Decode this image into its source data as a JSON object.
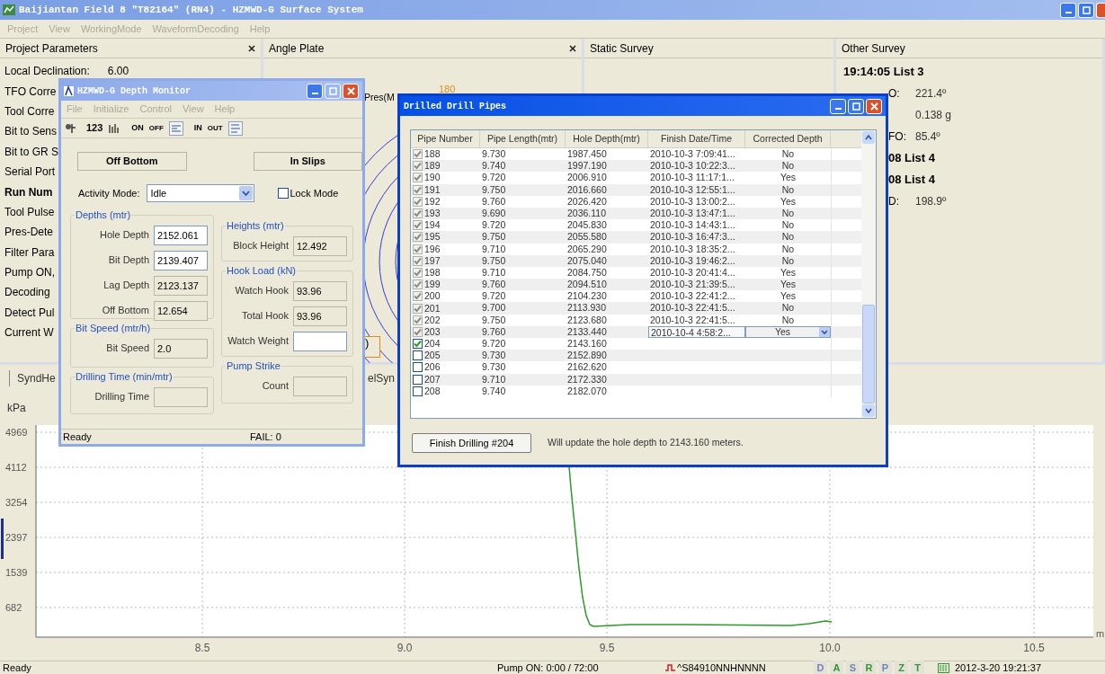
{
  "window": {
    "title": "Baijiantan Field 8 \"T82164\" (RN4) - HZMWD-G Surface System"
  },
  "menu": [
    {
      "label": "Project",
      "disabled": true
    },
    {
      "label": "View",
      "disabled": true
    },
    {
      "label": "WorkingMode",
      "disabled": true
    },
    {
      "label": "WaveformDecoding",
      "disabled": true
    },
    {
      "label": "Help",
      "disabled": true
    }
  ],
  "panels": [
    {
      "title": "Project Parameters",
      "closable": true
    },
    {
      "title": "Angle Plate",
      "closable": true
    },
    {
      "title": "Static Survey",
      "closable": false
    },
    {
      "title": "Other Survey",
      "closable": false
    }
  ],
  "project_parameters": [
    {
      "label": "Local Declination:",
      "value": "6.00",
      "bold": false
    },
    {
      "label": "TFO Corre",
      "bold": false
    },
    {
      "label": "Tool Corre",
      "bold": false
    },
    {
      "label": "Bit to Sens",
      "bold": false
    },
    {
      "label": "Bit to GR S",
      "bold": false
    },
    {
      "label": "Serial Port",
      "bold": false
    },
    {
      "label": "Run Num",
      "bold": true
    },
    {
      "label": "Tool Pulse",
      "bold": false
    },
    {
      "label": "Pres-Dete",
      "bold": false
    },
    {
      "label": "Filter Para",
      "bold": false
    },
    {
      "label": "Pump ON,",
      "bold": false
    },
    {
      "label": "Decoding",
      "bold": false
    },
    {
      "label": "Detect Pul",
      "bold": false
    },
    {
      "label": "Current W",
      "bold": false
    }
  ],
  "angle_plate": {
    "pressure_label": "Pres(M",
    "angle_label": "180",
    "box_label": ")"
  },
  "other_survey": [
    {
      "label": "19:14:05 List 3",
      "bold": true
    },
    {
      "label": "O:",
      "value": "221.4º",
      "bold": false
    },
    {
      "value": "0.138 g"
    },
    {
      "label": "FO:",
      "value": "85.4º",
      "bold": false
    },
    {
      "label": "08 List 4",
      "bold": true
    },
    {
      "label": "08 List 4",
      "bold": true
    },
    {
      "label": "D:",
      "value": "198.9º",
      "bold": false
    }
  ],
  "trend": {
    "tabs": [
      "SyndHe",
      "elSyn"
    ],
    "unit": "kPa",
    "x_unit": "m",
    "y_labels": [
      "4969",
      "4112",
      "3254",
      "2397",
      "1539",
      "682"
    ],
    "x_labels": [
      "8.5",
      "9.0",
      "9.5",
      "10.0",
      "10.5"
    ]
  },
  "status_bar": {
    "text": "Ready",
    "pump": "Pump ON: 0:00 / 72:00",
    "code": "^S84910NNHNNNN",
    "flags": [
      {
        "label": "D",
        "color": "#6f86b8"
      },
      {
        "label": "A",
        "color": "#2f9a2f"
      },
      {
        "label": "S",
        "color": "#6f86b8"
      },
      {
        "label": "R",
        "color": "#2f9a2f"
      },
      {
        "label": "P",
        "color": "#6f86b8"
      },
      {
        "label": "Z",
        "color": "#2f9a2f"
      },
      {
        "label": "T",
        "color": "#2f9a2f"
      }
    ],
    "datetime": "2012-3-20 19:21:37"
  },
  "depth_monitor": {
    "title": "HZMWD-G Depth Monitor",
    "menu": [
      {
        "label": "File",
        "disabled": true
      },
      {
        "label": "Initialize",
        "disabled": true
      },
      {
        "label": "Control",
        "disabled": true
      },
      {
        "label": "View",
        "disabled": true
      },
      {
        "label": "Help",
        "disabled": true
      }
    ],
    "toolbar": [
      "123",
      "ON",
      "OFF",
      "IN",
      "OUT"
    ],
    "buttons": [
      "Off Bottom",
      "In Slips"
    ],
    "activity_mode": {
      "label": "Activity Mode:",
      "value": "Idle"
    },
    "lock_mode": {
      "label": "Lock Mode",
      "checked": false
    },
    "left_groups": [
      {
        "title": "Depths (mtr)",
        "fields": [
          {
            "label": "Hole Depth",
            "value": "2152.061",
            "editable": true
          },
          {
            "label": "Bit Depth",
            "value": "2139.407",
            "editable": true
          },
          {
            "label": "Lag Depth",
            "value": "2123.137",
            "editable": false
          },
          {
            "label": "Off Bottom",
            "value": "12.654",
            "editable": false
          }
        ]
      },
      {
        "title": "Bit Speed (mtr/h)",
        "fields": [
          {
            "label": "Bit Speed",
            "value": "2.0",
            "editable": false
          }
        ]
      },
      {
        "title": "Drilling Time (min/mtr)",
        "fields": [
          {
            "label": "Drilling Time",
            "editable": false
          }
        ]
      }
    ],
    "right_groups": [
      {
        "title": "Heights (mtr)",
        "fields": [
          {
            "label": "Block Height",
            "value": "12.492",
            "editable": false
          }
        ]
      },
      {
        "title": "Hook Load (kN)",
        "fields": [
          {
            "label": "Watch Hook",
            "value": "93.96",
            "editable": false
          },
          {
            "label": "Total Hook",
            "value": "93.96",
            "editable": false
          },
          {
            "label": "Watch Weight",
            "editable": true
          }
        ]
      },
      {
        "title": "Pump Strike",
        "fields": [
          {
            "label": "Count",
            "editable": false
          }
        ]
      }
    ],
    "status": "Ready",
    "fail": "FAIL: 0"
  },
  "pipes_dialog": {
    "title": "Drilled Drill Pipes",
    "columns": [
      "Pipe Number",
      "Pipe Length(mtr)",
      "Hole Depth(mtr)",
      "Finish Date/Time",
      "Corrected Depth"
    ],
    "rows": [
      {
        "number": "188",
        "length": "9.730",
        "depth": "1987.450",
        "finish": "2010-10-3 7:09:41...",
        "corrected": "No",
        "checked": true,
        "disabled": true,
        "editing": false
      },
      {
        "number": "189",
        "length": "9.740",
        "depth": "1997.190",
        "finish": "2010-10-3 10:22:3...",
        "corrected": "No",
        "checked": true,
        "disabled": true,
        "editing": false
      },
      {
        "number": "190",
        "length": "9.720",
        "depth": "2006.910",
        "finish": "2010-10-3 11:17:1...",
        "corrected": "Yes",
        "checked": true,
        "disabled": true,
        "editing": false
      },
      {
        "number": "191",
        "length": "9.750",
        "depth": "2016.660",
        "finish": "2010-10-3 12:55:1...",
        "corrected": "No",
        "checked": true,
        "disabled": true,
        "editing": false
      },
      {
        "number": "192",
        "length": "9.760",
        "depth": "2026.420",
        "finish": "2010-10-3 13:00:2...",
        "corrected": "Yes",
        "checked": true,
        "disabled": true,
        "editing": false
      },
      {
        "number": "193",
        "length": "9.690",
        "depth": "2036.110",
        "finish": "2010-10-3 13:47:1...",
        "corrected": "No",
        "checked": true,
        "disabled": true,
        "editing": false
      },
      {
        "number": "194",
        "length": "9.720",
        "depth": "2045.830",
        "finish": "2010-10-3 14:43:1...",
        "corrected": "No",
        "checked": true,
        "disabled": true,
        "editing": false
      },
      {
        "number": "195",
        "length": "9.750",
        "depth": "2055.580",
        "finish": "2010-10-3 16:47:3...",
        "corrected": "No",
        "checked": true,
        "disabled": true,
        "editing": false
      },
      {
        "number": "196",
        "length": "9.710",
        "depth": "2065.290",
        "finish": "2010-10-3 18:35:2...",
        "corrected": "No",
        "checked": true,
        "disabled": true,
        "editing": false
      },
      {
        "number": "197",
        "length": "9.750",
        "depth": "2075.040",
        "finish": "2010-10-3 19:46:2...",
        "corrected": "No",
        "checked": true,
        "disabled": true,
        "editing": false
      },
      {
        "number": "198",
        "length": "9.710",
        "depth": "2084.750",
        "finish": "2010-10-3 20:41:4...",
        "corrected": "Yes",
        "checked": true,
        "disabled": true,
        "editing": false
      },
      {
        "number": "199",
        "length": "9.760",
        "depth": "2094.510",
        "finish": "2010-10-3 21:39:5...",
        "corrected": "Yes",
        "checked": true,
        "disabled": true,
        "editing": false
      },
      {
        "number": "200",
        "length": "9.720",
        "depth": "2104.230",
        "finish": "2010-10-3 22:41:2...",
        "corrected": "Yes",
        "checked": true,
        "disabled": true,
        "editing": false
      },
      {
        "number": "201",
        "length": "9.700",
        "depth": "2113.930",
        "finish": "2010-10-3 22:41:5...",
        "corrected": "No",
        "checked": true,
        "disabled": true,
        "editing": false
      },
      {
        "number": "202",
        "length": "9.750",
        "depth": "2123.680",
        "finish": "2010-10-3 22:41:5...",
        "corrected": "No",
        "checked": true,
        "disabled": true,
        "editing": false
      },
      {
        "number": "203",
        "length": "9.760",
        "depth": "2133.440",
        "finish": "2010-10-4 4:58:2...",
        "corrected": "Yes",
        "checked": true,
        "disabled": true,
        "editing": true
      },
      {
        "number": "204",
        "length": "9.720",
        "depth": "2143.160",
        "checked": true,
        "disabled": false,
        "editing": false
      },
      {
        "number": "205",
        "length": "9.730",
        "depth": "2152.890",
        "checked": false,
        "disabled": false,
        "editing": false
      },
      {
        "number": "206",
        "length": "9.730",
        "depth": "2162.620",
        "checked": false,
        "disabled": false,
        "editing": false
      },
      {
        "number": "207",
        "length": "9.710",
        "depth": "2172.330",
        "checked": false,
        "disabled": false,
        "editing": false
      },
      {
        "number": "208",
        "length": "9.740",
        "depth": "2182.070",
        "checked": false,
        "disabled": false,
        "editing": false
      }
    ],
    "button": "Finish Drilling #204",
    "message": "Will update the hole depth to 2143.160 meters."
  }
}
